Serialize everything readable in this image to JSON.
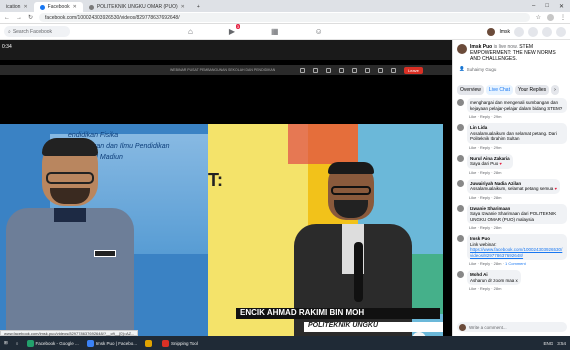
{
  "browser": {
    "tabs": [
      {
        "label": "ication",
        "active": false
      },
      {
        "label": "Facebook",
        "active": true
      },
      {
        "label": "POLITEKNIK UNGKU OMAR (PUO)",
        "active": false
      }
    ],
    "window_controls": [
      "–",
      "□",
      "✕"
    ],
    "url": "facebook.com/100024303926530/videos/829778637692648/"
  },
  "facebook": {
    "search_placeholder": "Search Facebook",
    "notification_count": "3",
    "user_name": "Imsk"
  },
  "video": {
    "timestamp": "0:34",
    "meeting_title": "WEBINAR PUSAT PEMBANGUNAN SEKOLAH DAN PENDIDIKAN",
    "leave_label": "Leave",
    "banner_lines": [
      "endidikan Fisika",
      "n Keguruan dan Ilmu Pendidikan",
      "itas PGRI Madiun"
    ],
    "big_letter": "T:",
    "lower_third_name": "ENCIK AHMAD RAKIMI BIN MOH",
    "lower_third_org": "POLITEKNIK UNGKU",
    "badge": "LR",
    "status_url": "www.facebook.com/imsk.puo/videos/829778637692648/?__cft__[0]=AZ..."
  },
  "sidebar": {
    "poster_name": "Imsk Puo",
    "poster_status": "is live now.",
    "live_title": "STEM EMPOWERMENT: THE NEW NORMS AND CHALLENGES.",
    "sub_name": "Suhaimy Gugu",
    "tabs": [
      "Overview",
      "Live Chat",
      "Your Replies"
    ],
    "comments": [
      {
        "name": "",
        "text": "menghargai dan mengenali sumbangan dan kejayaan pelajar-pelajar dalam bidang STEM?",
        "actions": "Like · Reply · 29m"
      },
      {
        "name": "Lin Lida",
        "text": "Assalamualaikum dan selamat petang. Dari Politeknik Ibrahim Sultan",
        "actions": "Like · Reply · 29m"
      },
      {
        "name": "Nurul Aina Zakaria",
        "text": "Saya dari Puo",
        "actions": "Like · Reply · 28m"
      },
      {
        "name": "Juwairiyah Nadia Azilan",
        "text": "Assalamualaikum, selamat petang semua",
        "actions": "Like · Reply · 28m"
      },
      {
        "name": "Izwanie Sharimaan",
        "text": "Saya Izwanie Sharimaan dari POLITEKNIK UNGKU OMAR (PUO) malaysia",
        "actions": "Like · Reply · 28m"
      },
      {
        "name": "Imsk Puo",
        "text": "Link webinar:",
        "link": "https://www.facebook.com/100024303926530/videos/829778637692648/",
        "actions": "Like · Reply · 28m"
      },
      {
        "name": "Mohd Ai",
        "text": "Asharun dr zoom maa x",
        "actions": "Like · Reply · 28m"
      }
    ],
    "reply_count": "1 Comment",
    "comment_placeholder": "Write a comment..."
  },
  "taskbar": {
    "items": [
      "Facebook - Google ...",
      "Imsk Puo | Facebo...",
      "",
      "Snipping Tool"
    ],
    "tray": [
      "ENG",
      "3:54"
    ]
  }
}
